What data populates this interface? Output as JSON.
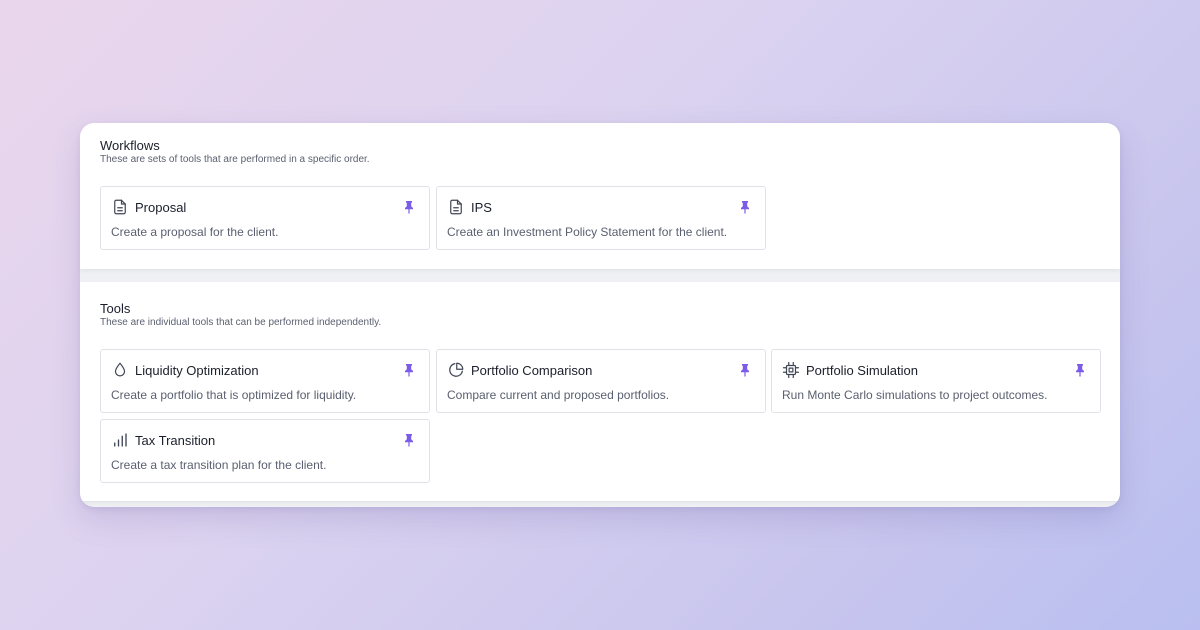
{
  "colors": {
    "pin": "#7b5ce6",
    "icon": "#3f4654"
  },
  "workflows": {
    "title": "Workflows",
    "subtitle": "These are sets of tools that are performed in a specific order.",
    "cards": [
      {
        "icon": "document-icon",
        "title": "Proposal",
        "description": "Create a proposal for the client."
      },
      {
        "icon": "document-icon",
        "title": "IPS",
        "description": "Create an Investment Policy Statement for the client."
      }
    ]
  },
  "tools": {
    "title": "Tools",
    "subtitle": "These are individual tools that can be performed independently.",
    "cards": [
      {
        "icon": "droplet-icon",
        "title": "Liquidity Optimization",
        "description": "Create a portfolio that is optimized for liquidity."
      },
      {
        "icon": "pie-chart-icon",
        "title": "Portfolio Comparison",
        "description": "Compare current and proposed portfolios."
      },
      {
        "icon": "cpu-chip-icon",
        "title": "Portfolio Simulation",
        "description": "Run Monte Carlo simulations to project outcomes."
      },
      {
        "icon": "bar-chart-icon",
        "title": "Tax Transition",
        "description": "Create a tax transition plan for the client."
      }
    ]
  }
}
